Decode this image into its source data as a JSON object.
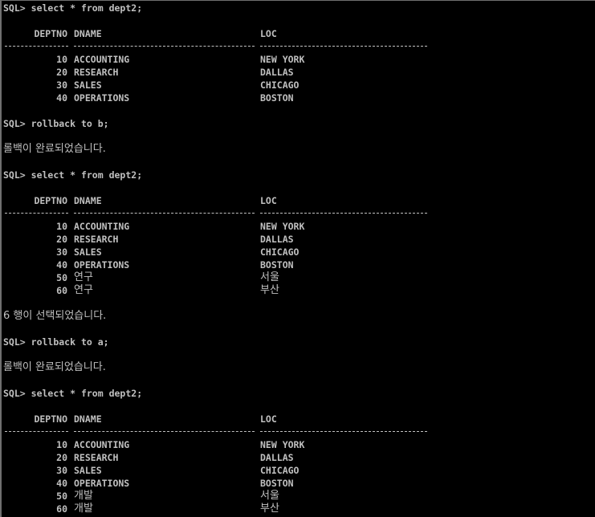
{
  "console": {
    "foreground": "#c0c0c0",
    "background": "#000000",
    "prompt": "SQL>",
    "blocks": [
      {
        "command": "select * from dept2;",
        "headers": {
          "deptno": "DEPTNO",
          "dname": "DNAME",
          "loc": "LOC"
        },
        "rows": [
          {
            "deptno": "10",
            "dname": "ACCOUNTING",
            "loc": "NEW YORK"
          },
          {
            "deptno": "20",
            "dname": "RESEARCH",
            "loc": "DALLAS"
          },
          {
            "deptno": "30",
            "dname": "SALES",
            "loc": "CHICAGO"
          },
          {
            "deptno": "40",
            "dname": "OPERATIONS",
            "loc": "BOSTON"
          }
        ]
      },
      {
        "command": "rollback to b;",
        "message": "롤백이 완료되었습니다."
      },
      {
        "command": "select * from dept2;",
        "headers": {
          "deptno": "DEPTNO",
          "dname": "DNAME",
          "loc": "LOC"
        },
        "rows": [
          {
            "deptno": "10",
            "dname": "ACCOUNTING",
            "loc": "NEW YORK"
          },
          {
            "deptno": "20",
            "dname": "RESEARCH",
            "loc": "DALLAS"
          },
          {
            "deptno": "30",
            "dname": "SALES",
            "loc": "CHICAGO"
          },
          {
            "deptno": "40",
            "dname": "OPERATIONS",
            "loc": "BOSTON"
          },
          {
            "deptno": "50",
            "dname": "연구",
            "loc": "서울"
          },
          {
            "deptno": "60",
            "dname": "연구",
            "loc": "부산"
          }
        ],
        "message": "6 행이 선택되었습니다."
      },
      {
        "command": "rollback to a;",
        "message": "롤백이 완료되었습니다."
      },
      {
        "command": "select * from dept2;",
        "headers": {
          "deptno": "DEPTNO",
          "dname": "DNAME",
          "loc": "LOC"
        },
        "rows": [
          {
            "deptno": "10",
            "dname": "ACCOUNTING",
            "loc": "NEW YORK"
          },
          {
            "deptno": "20",
            "dname": "RESEARCH",
            "loc": "DALLAS"
          },
          {
            "deptno": "30",
            "dname": "SALES",
            "loc": "CHICAGO"
          },
          {
            "deptno": "40",
            "dname": "OPERATIONS",
            "loc": "BOSTON"
          },
          {
            "deptno": "50",
            "dname": "개발",
            "loc": "서울"
          },
          {
            "deptno": "60",
            "dname": "개발",
            "loc": "부산"
          }
        ]
      }
    ]
  }
}
